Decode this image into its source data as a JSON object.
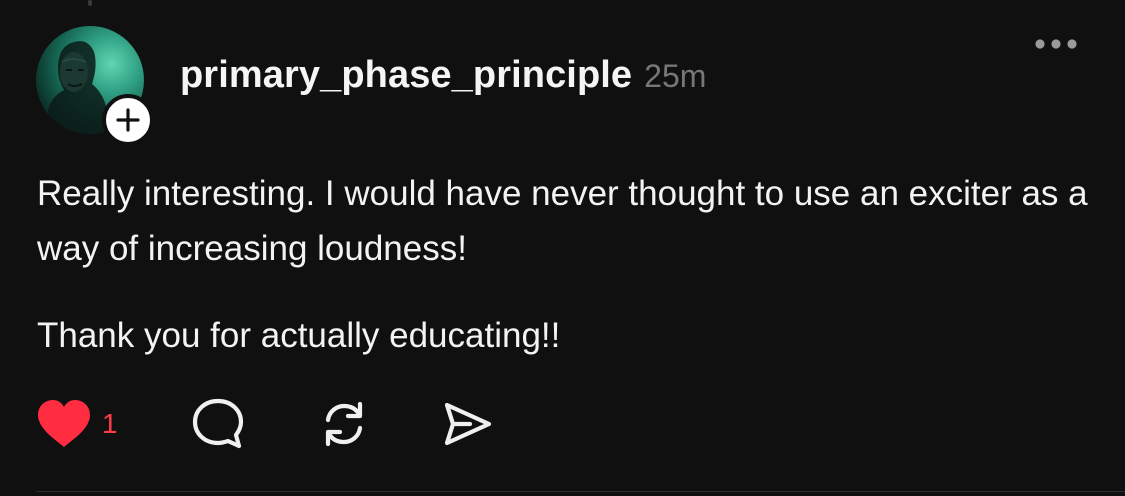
{
  "post": {
    "author": {
      "username": "primary_phase_principle",
      "avatar_icon": "user-avatar"
    },
    "timestamp": "25m",
    "follow_icon": "plus-icon",
    "more_icon": "more-options-icon",
    "body": {
      "paragraph_1": "Really interesting. I would have never thought to use an exciter as a way of increasing loudness!",
      "paragraph_2": "Thank you for actually educating!!"
    },
    "actions": {
      "like": {
        "icon": "heart-icon",
        "count": "1",
        "liked": true,
        "color": "#ff3b48"
      },
      "reply": {
        "icon": "comment-bubble-icon"
      },
      "repost": {
        "icon": "repost-icon"
      },
      "share": {
        "icon": "send-icon"
      }
    }
  },
  "colors": {
    "background": "#101010",
    "text": "#f3f3f3",
    "muted": "#777777",
    "like_red": "#ff3b48",
    "avatar_accent": "#2f9e82"
  }
}
